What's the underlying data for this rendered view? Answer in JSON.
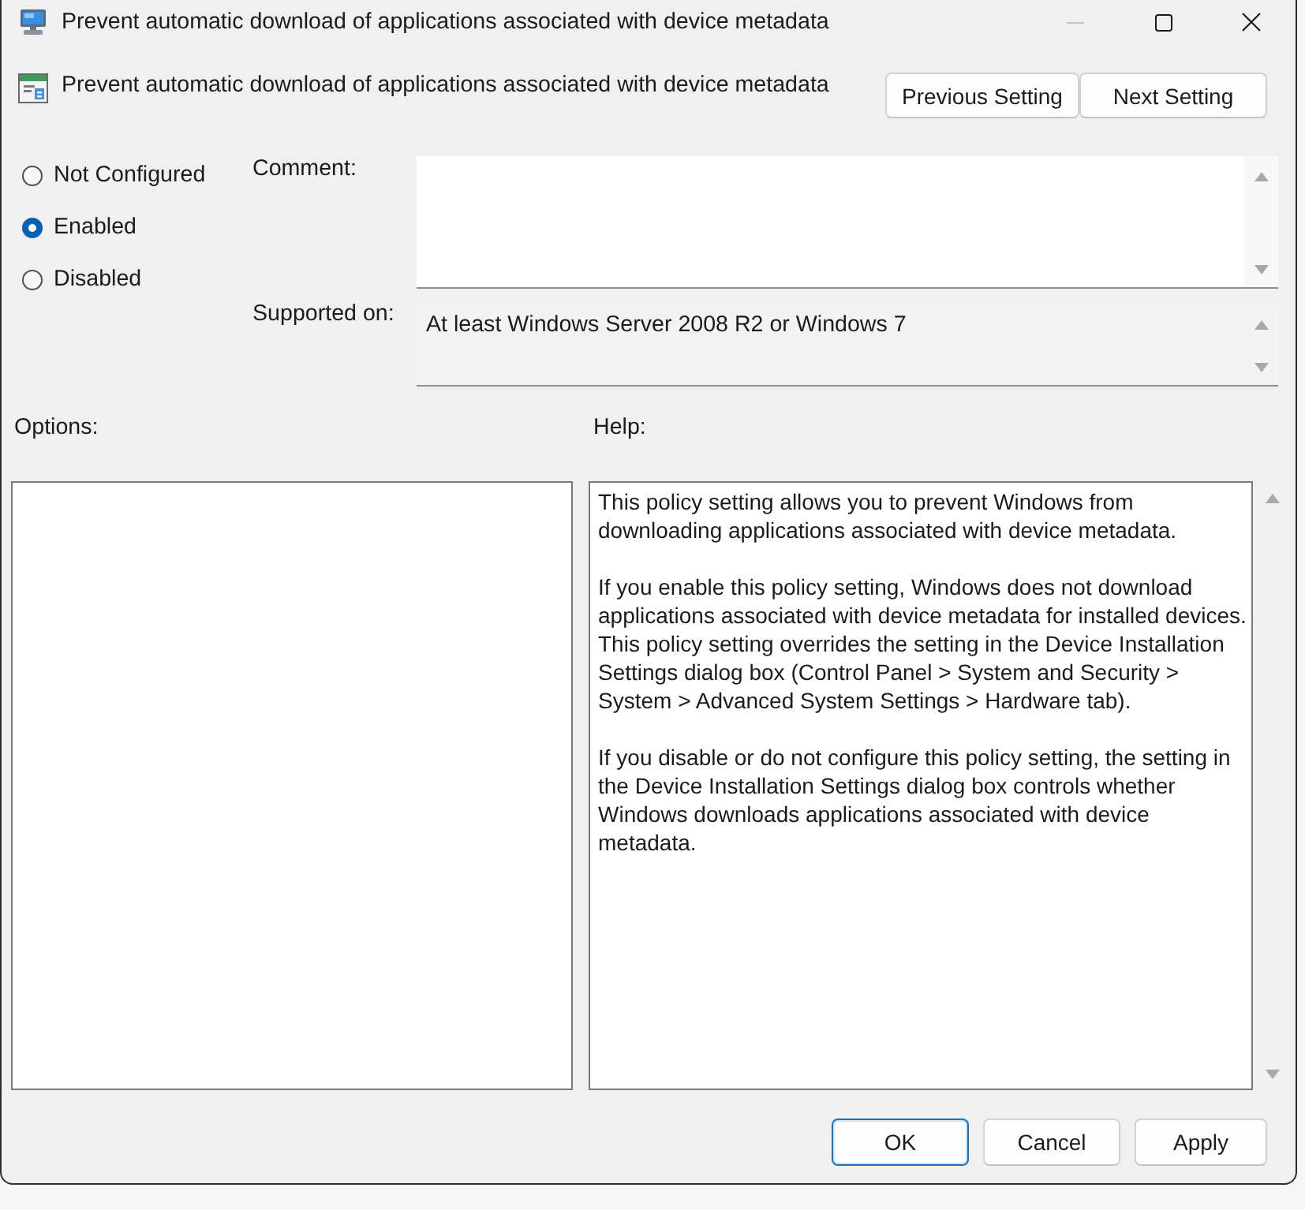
{
  "window": {
    "title": "Prevent automatic download of applications associated with device metadata"
  },
  "header": {
    "title": "Prevent automatic download of applications associated with device metadata",
    "buttons": [
      "Previous Setting",
      "Next Setting"
    ]
  },
  "state_options": [
    {
      "label": "Not Configured",
      "selected": false
    },
    {
      "label": "Enabled",
      "selected": true
    },
    {
      "label": "Disabled",
      "selected": false
    }
  ],
  "comment": {
    "label": "Comment:"
  },
  "supported_on": {
    "label": "Supported on:",
    "value": "At least Windows Server 2008 R2 or Windows 7"
  },
  "options": {
    "label": "Options:"
  },
  "help": {
    "label": "Help:",
    "paragraphs": [
      "This policy setting allows you to prevent Windows from downloading applications associated with device metadata.",
      "If you enable this policy setting, Windows does not download applications associated with device metadata for installed devices. This policy setting overrides the setting in the Device Installation Settings dialog box (Control Panel > System and Security > System > Advanced System Settings > Hardware tab).",
      "If you disable or do not configure this policy setting, the setting in the Device Installation Settings dialog box controls whether Windows downloads applications associated with device metadata."
    ]
  },
  "buttons": [
    {
      "label": "OK",
      "default": true
    },
    {
      "label": "Cancel",
      "default": false
    },
    {
      "label": "Apply",
      "default": false
    }
  ]
}
